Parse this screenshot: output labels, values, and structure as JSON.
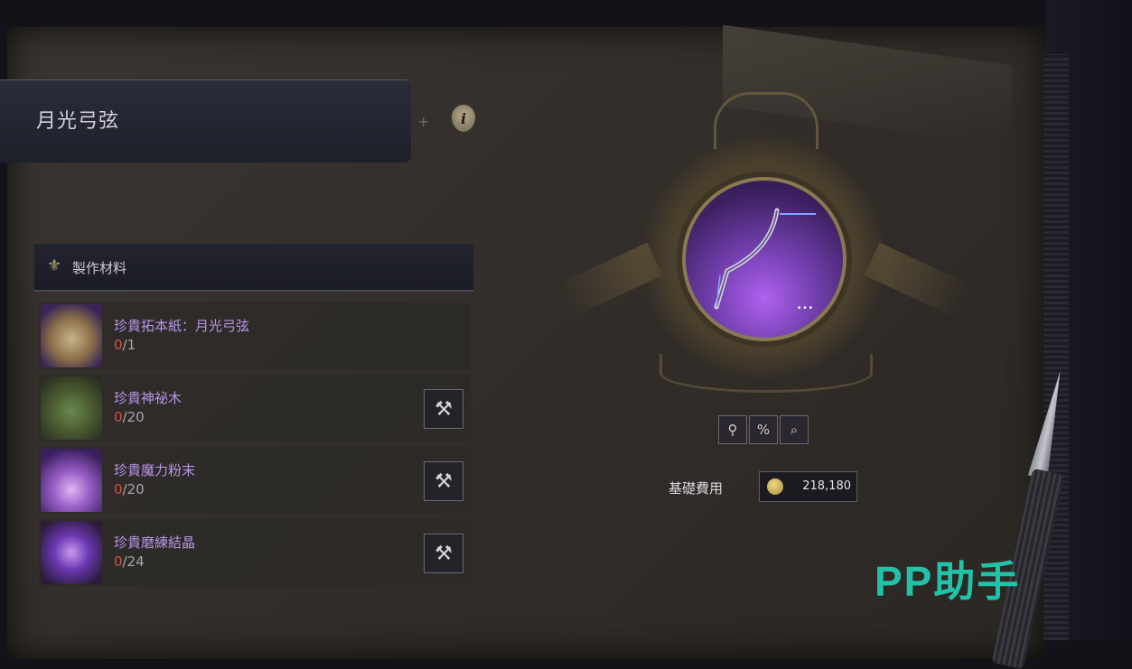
{
  "title": "月光弓弦",
  "materials_header": "製作材料",
  "materials": [
    {
      "name": "珍貴拓本紙：月光弓弦",
      "have": "0",
      "need": "/1",
      "craftable": false
    },
    {
      "name": "珍貴神祕木",
      "have": "0",
      "need": "/20",
      "craftable": true
    },
    {
      "name": "珍貴魔力粉末",
      "have": "0",
      "need": "/20",
      "craftable": true
    },
    {
      "name": "珍貴磨練結晶",
      "have": "0",
      "need": "/24",
      "craftable": true
    }
  ],
  "item_more": "...",
  "tools": [
    "map-pin-icon",
    "percent-icon",
    "magnifier-icon"
  ],
  "cost": {
    "label": "基礎費用",
    "value": "218,180"
  },
  "watermark": "PP助手"
}
